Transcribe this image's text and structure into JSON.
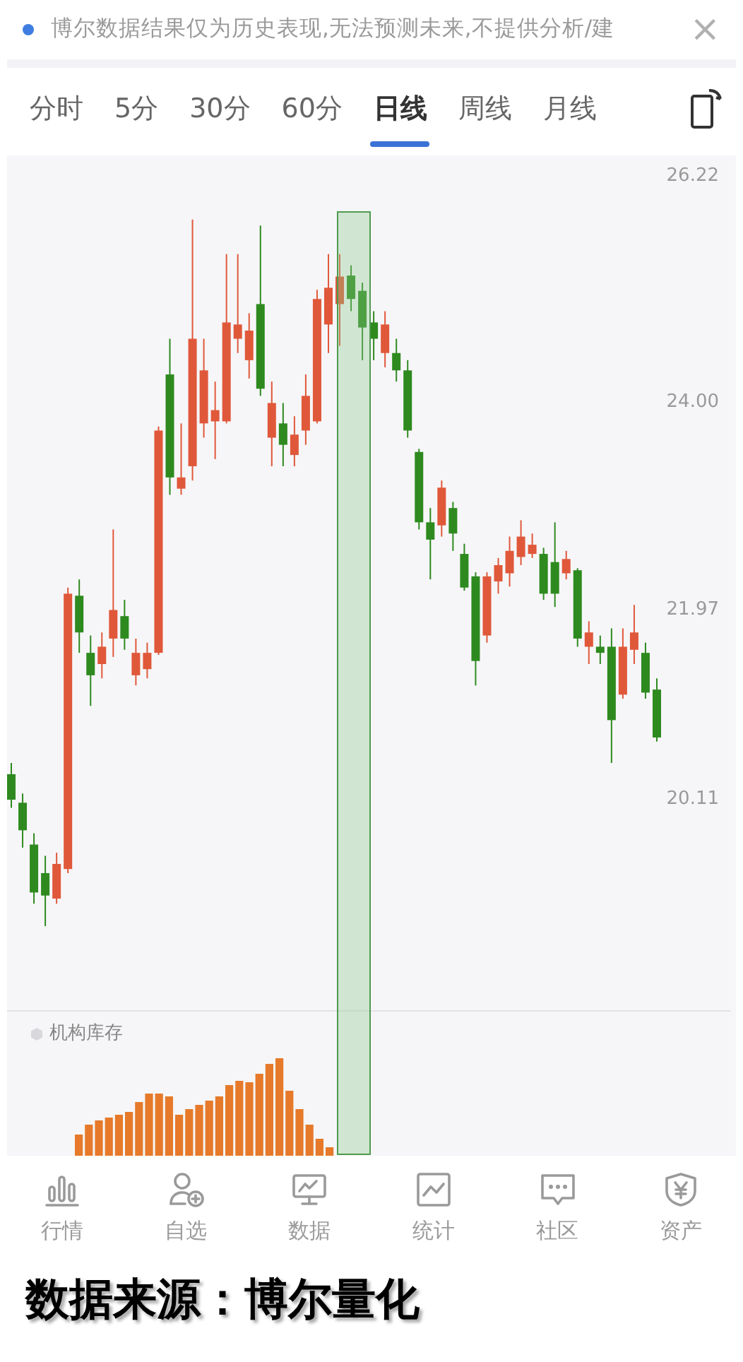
{
  "notice": {
    "text": "博尔数据结果仅为历史表现,无法预测未来,不提供分析/建",
    "close": "×"
  },
  "tabs": [
    {
      "label": "分时",
      "selected": false
    },
    {
      "label": "5分",
      "selected": false
    },
    {
      "label": "30分",
      "selected": false
    },
    {
      "label": "60分",
      "selected": false
    },
    {
      "label": "日线",
      "selected": true
    },
    {
      "label": "周线",
      "selected": false
    },
    {
      "label": "月线",
      "selected": false
    }
  ],
  "chart_data": {
    "type": "candlestick",
    "ohlc": [
      [
        20.36,
        20.47,
        20.03,
        20.11
      ],
      [
        20.08,
        20.17,
        19.64,
        19.81
      ],
      [
        19.67,
        19.78,
        19.09,
        19.2
      ],
      [
        19.39,
        19.56,
        18.87,
        19.17
      ],
      [
        19.14,
        19.59,
        19.09,
        19.48
      ],
      [
        19.43,
        22.19,
        19.39,
        22.13
      ],
      [
        22.11,
        22.27,
        21.55,
        21.75
      ],
      [
        21.55,
        21.72,
        21.03,
        21.33
      ],
      [
        21.44,
        21.75,
        21.3,
        21.61
      ],
      [
        21.69,
        22.76,
        21.51,
        21.97
      ],
      [
        21.91,
        22.07,
        21.58,
        21.69
      ],
      [
        21.33,
        21.69,
        21.23,
        21.55
      ],
      [
        21.39,
        21.65,
        21.3,
        21.55
      ],
      [
        21.55,
        23.77,
        21.53,
        23.73
      ],
      [
        24.28,
        24.63,
        23.1,
        23.27
      ],
      [
        23.16,
        23.8,
        23.1,
        23.27
      ],
      [
        23.38,
        25.8,
        23.24,
        24.63
      ],
      [
        23.8,
        24.63,
        23.66,
        24.32
      ],
      [
        23.82,
        24.21,
        23.45,
        23.93
      ],
      [
        23.82,
        25.46,
        23.8,
        24.79
      ],
      [
        24.63,
        25.46,
        24.49,
        24.77
      ],
      [
        24.42,
        24.88,
        24.24,
        24.71
      ],
      [
        24.97,
        25.74,
        24.07,
        24.14
      ],
      [
        23.66,
        24.21,
        23.38,
        24.0
      ],
      [
        23.8,
        24.0,
        23.38,
        23.59
      ],
      [
        23.49,
        23.87,
        23.38,
        23.69
      ],
      [
        23.73,
        24.28,
        23.59,
        24.07
      ],
      [
        23.82,
        25.11,
        23.8,
        25.02
      ],
      [
        24.77,
        25.46,
        24.49,
        25.13
      ],
      [
        24.97,
        25.46,
        24.56,
        25.24
      ],
      [
        25.25,
        25.35,
        24.9,
        25.02
      ],
      [
        25.1,
        25.18,
        24.42,
        24.74
      ],
      [
        24.79,
        24.9,
        24.42,
        24.63
      ],
      [
        24.49,
        24.9,
        24.35,
        24.77
      ],
      [
        24.49,
        24.63,
        24.21,
        24.32
      ],
      [
        24.32,
        24.42,
        23.66,
        23.73
      ],
      [
        23.52,
        23.55,
        22.76,
        22.83
      ],
      [
        22.83,
        22.97,
        22.27,
        22.66
      ],
      [
        22.8,
        23.24,
        22.69,
        23.17
      ],
      [
        22.97,
        23.03,
        22.55,
        22.72
      ],
      [
        22.52,
        22.62,
        22.16,
        22.19
      ],
      [
        22.3,
        22.34,
        21.23,
        21.47
      ],
      [
        21.72,
        22.34,
        21.65,
        22.3
      ],
      [
        22.25,
        22.48,
        22.13,
        22.41
      ],
      [
        22.33,
        22.69,
        22.2,
        22.55
      ],
      [
        22.49,
        22.85,
        22.41,
        22.69
      ],
      [
        22.52,
        22.72,
        22.48,
        22.61
      ],
      [
        22.52,
        22.58,
        22.07,
        22.13
      ],
      [
        22.44,
        22.83,
        22.0,
        22.13
      ],
      [
        22.33,
        22.55,
        22.27,
        22.47
      ],
      [
        22.36,
        22.38,
        21.61,
        21.69
      ],
      [
        21.61,
        21.86,
        21.44,
        21.75
      ],
      [
        21.61,
        21.72,
        21.44,
        21.55
      ],
      [
        21.61,
        21.79,
        20.47,
        20.89
      ],
      [
        21.14,
        21.79,
        21.1,
        21.61
      ],
      [
        21.58,
        22.02,
        21.44,
        21.75
      ],
      [
        21.55,
        21.65,
        21.1,
        21.16
      ],
      [
        21.19,
        21.3,
        20.68,
        20.72
      ]
    ],
    "ylim": [
      20.11,
      26.22
    ],
    "yticks": [
      {
        "value": 26.22,
        "label": "26.22"
      },
      {
        "value": 24,
        "label": "24.00"
      },
      {
        "value": 21.97,
        "label": "21.97"
      },
      {
        "value": 20.11,
        "label": "20.11"
      }
    ]
  },
  "indicator": {
    "title": "机构库存"
  },
  "nav": [
    {
      "label": "行情",
      "kind": "bars",
      "selected": false
    },
    {
      "label": "自选",
      "kind": "user",
      "selected": false
    },
    {
      "label": "数据",
      "kind": "monitor",
      "selected": false
    },
    {
      "label": "统计",
      "kind": "chart",
      "selected": false
    },
    {
      "label": "社区",
      "kind": "chat",
      "selected": false
    },
    {
      "label": "资产",
      "kind": "shield",
      "selected": false
    }
  ],
  "footer": "数据来源：博尔量化"
}
